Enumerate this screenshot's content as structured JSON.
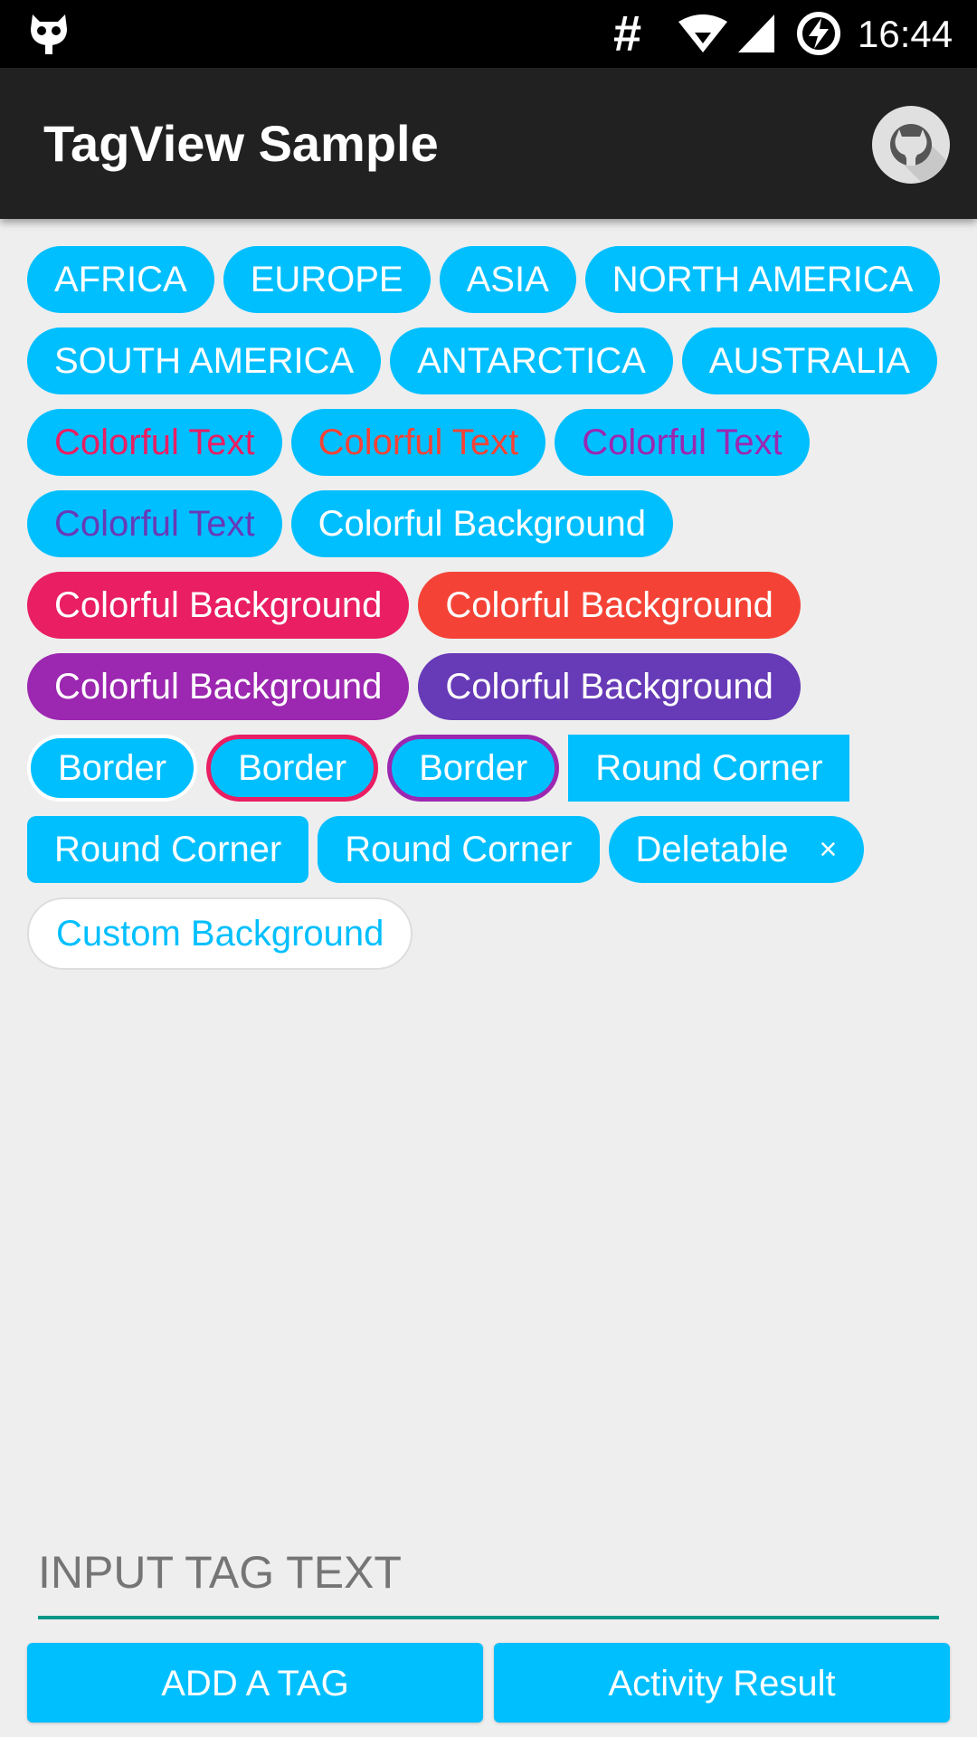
{
  "status_bar": {
    "hash_symbol": "#",
    "time": "16:44",
    "icons": [
      "app-notification-icon",
      "wifi-icon",
      "cell-signal-icon",
      "battery-charging-icon"
    ]
  },
  "app_bar": {
    "title": "TagView Sample",
    "action_icon": "github-icon"
  },
  "tags": [
    {
      "label": "AFRICA",
      "bg": "#00BFFF",
      "fg": "#FFFFFF"
    },
    {
      "label": "EUROPE",
      "bg": "#00BFFF",
      "fg": "#FFFFFF"
    },
    {
      "label": "ASIA",
      "bg": "#00BFFF",
      "fg": "#FFFFFF"
    },
    {
      "label": "NORTH AMERICA",
      "bg": "#00BFFF",
      "fg": "#FFFFFF"
    },
    {
      "label": "SOUTH AMERICA",
      "bg": "#00BFFF",
      "fg": "#FFFFFF"
    },
    {
      "label": "ANTARCTICA",
      "bg": "#00BFFF",
      "fg": "#FFFFFF"
    },
    {
      "label": "AUSTRALIA",
      "bg": "#00BFFF",
      "fg": "#FFFFFF"
    },
    {
      "label": "Colorful Text",
      "bg": "#00BFFF",
      "fg": "#E91E63"
    },
    {
      "label": "Colorful Text",
      "bg": "#00BFFF",
      "fg": "#F44336"
    },
    {
      "label": "Colorful Text",
      "bg": "#00BFFF",
      "fg": "#9C27B0"
    },
    {
      "label": "Colorful Text",
      "bg": "#00BFFF",
      "fg": "#673AB7"
    },
    {
      "label": "Colorful Background",
      "bg": "#00BFFF",
      "fg": "#FFFFFF"
    },
    {
      "label": "Colorful Background",
      "bg": "#E91E63",
      "fg": "#FFFFFF"
    },
    {
      "label": "Colorful Background",
      "bg": "#F44336",
      "fg": "#FFFFFF"
    },
    {
      "label": "Colorful Background",
      "bg": "#9C27B0",
      "fg": "#FFFFFF"
    },
    {
      "label": "Colorful Background",
      "bg": "#673AB7",
      "fg": "#FFFFFF"
    },
    {
      "label": "Border",
      "bg": "#00BFFF",
      "fg": "#FFFFFF",
      "border": "#FFFFFF"
    },
    {
      "label": "Border",
      "bg": "#00BFFF",
      "fg": "#FFFFFF",
      "border": "#E91E63"
    },
    {
      "label": "Border",
      "bg": "#00BFFF",
      "fg": "#FFFFFF",
      "border": "#9C27B0"
    },
    {
      "label": "Round Corner",
      "bg": "#00BFFF",
      "fg": "#FFFFFF",
      "corner": "none"
    },
    {
      "label": "Round Corner",
      "bg": "#00BFFF",
      "fg": "#FFFFFF",
      "corner": "small"
    },
    {
      "label": "Round Corner",
      "bg": "#00BFFF",
      "fg": "#FFFFFF",
      "corner": "medium"
    },
    {
      "label": "Deletable",
      "bg": "#00BFFF",
      "fg": "#FFFFFF",
      "delete_symbol": "×"
    },
    {
      "label": "Custom Background",
      "bg": "#FFFFFF",
      "fg": "#00BFFF"
    }
  ],
  "input": {
    "placeholder": "INPUT TAG TEXT",
    "value": ""
  },
  "buttons": {
    "add_label": "ADD A TAG",
    "result_label": "Activity Result"
  },
  "colors": {
    "accent": "#00BFFF",
    "app_bar": "#212121",
    "background": "#EEEEEE",
    "input_underline": "#009688"
  }
}
